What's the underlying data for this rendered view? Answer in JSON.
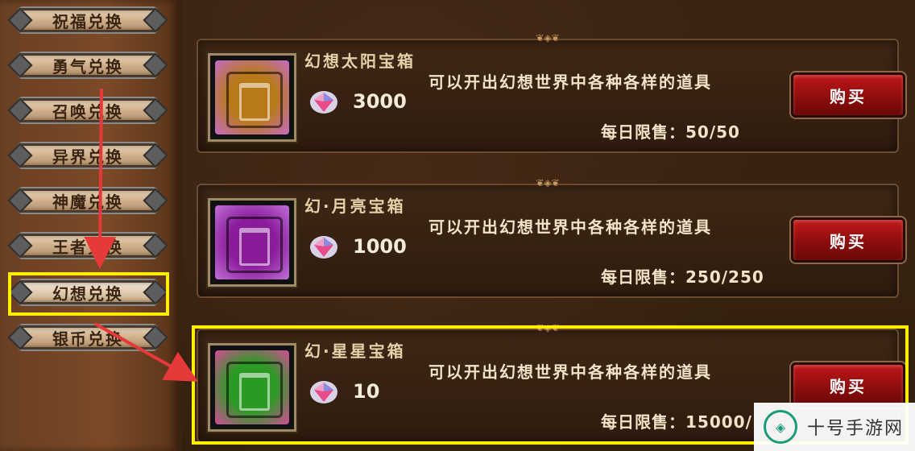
{
  "sidebar": {
    "tabs": [
      {
        "label": "祝福兑换"
      },
      {
        "label": "勇气兑换"
      },
      {
        "label": "召唤兑换"
      },
      {
        "label": "异界兑换"
      },
      {
        "label": "神魔兑换"
      },
      {
        "label": "王者兑换"
      },
      {
        "label": "幻想兑换",
        "active": true
      },
      {
        "label": "银币兑换"
      }
    ]
  },
  "items": [
    {
      "name": "幻想太阳宝箱",
      "price": "3000",
      "description": "可以开出幻想世界中各种各样的道具",
      "limit": "每日限售：50/50",
      "buy_label": "购买",
      "chest_color": "#b87a18",
      "glow_color": "#c66ac8"
    },
    {
      "name": "幻·月亮宝箱",
      "price": "1000",
      "description": "可以开出幻想世界中各种各样的道具",
      "limit": "每日限售：250/250",
      "buy_label": "购买",
      "chest_color": "#8a1c9a",
      "glow_color": "#c070d8"
    },
    {
      "name": "幻·星星宝箱",
      "price": "10",
      "description": "可以开出幻想世界中各种各样的道具",
      "limit": "每日限售：15000/",
      "buy_label": "购买",
      "chest_color": "#2a9a24",
      "glow_color": "#d64a9a"
    }
  ],
  "currency_icon": "diamond-gem-icon",
  "highlight_color": "#ffee00",
  "arrow_color": "#e63a3a",
  "watermark": {
    "text": "十号手游网",
    "logo": "shield-logo-icon",
    "brand_color": "#1b9b7a"
  }
}
